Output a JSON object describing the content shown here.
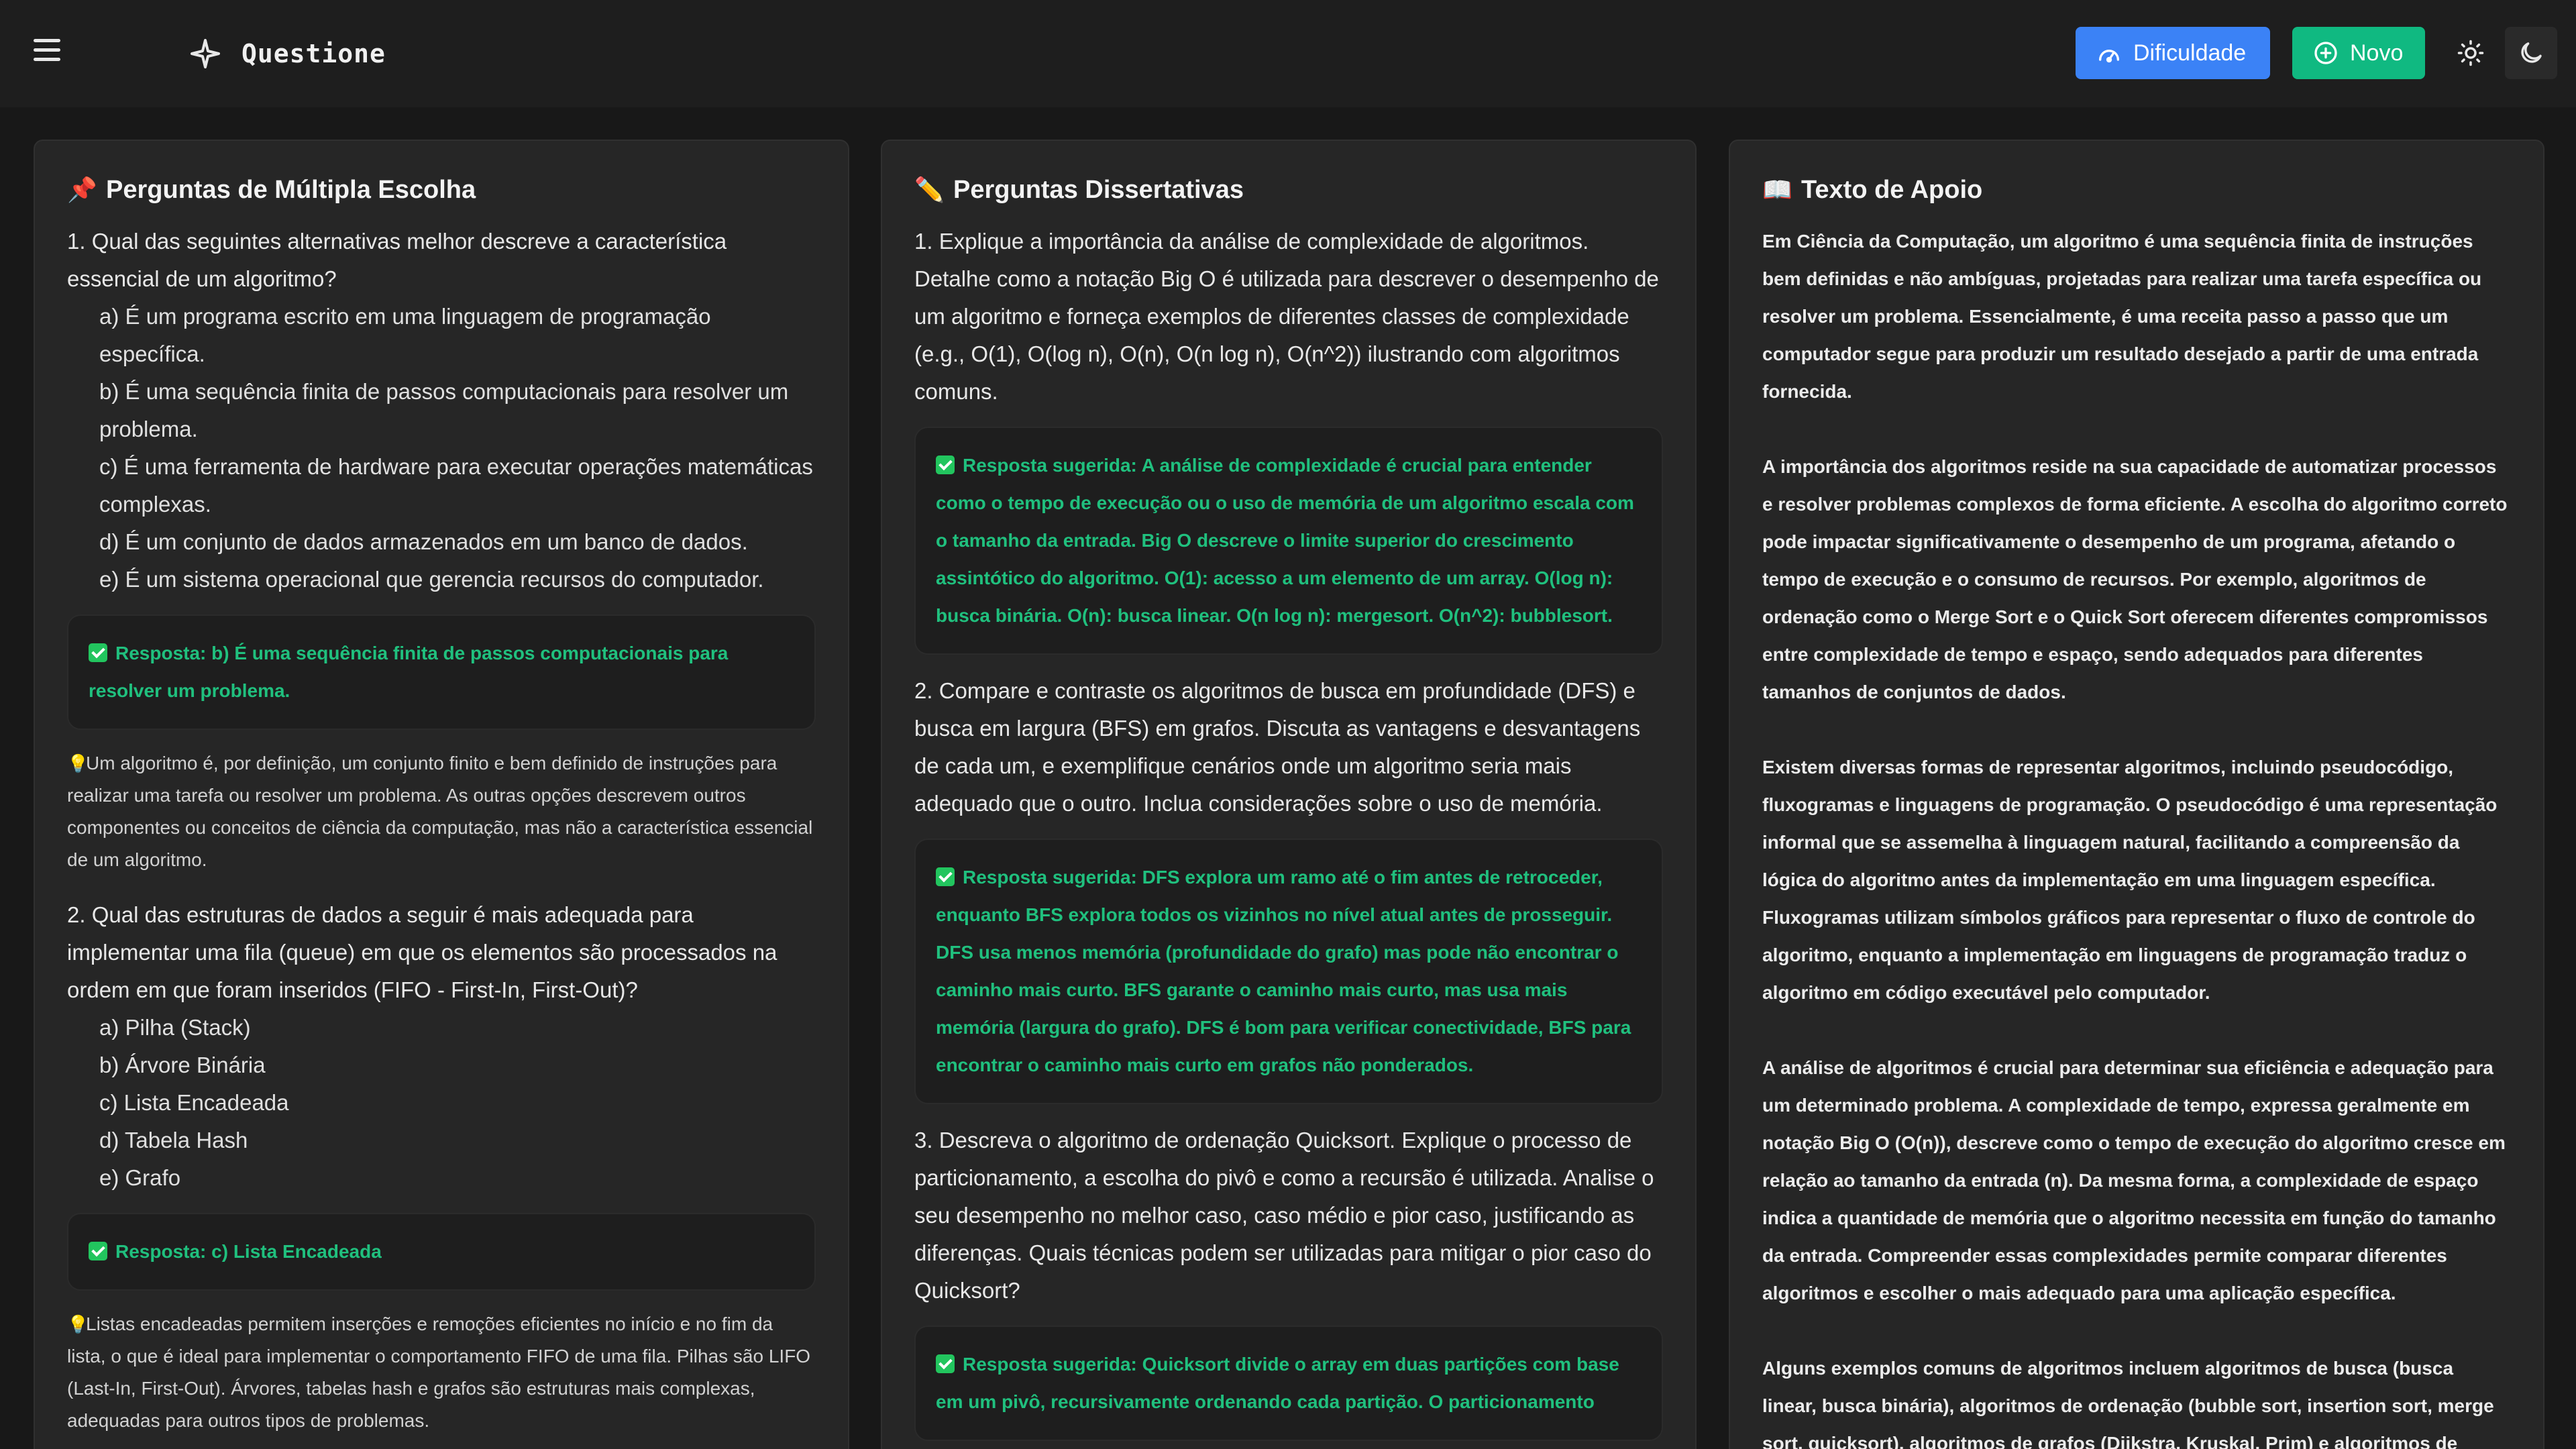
{
  "header": {
    "title": "Questione",
    "difficulty_label": "Dificuldade",
    "new_label": "Novo"
  },
  "colors": {
    "accent_blue": "#3b82f6",
    "accent_green": "#10b981",
    "answer_green": "#20c07e"
  },
  "mc": {
    "heading": "Perguntas de Múltipla Escolha",
    "heading_emoji": "📌",
    "questions": [
      {
        "text": "1. Qual das seguintes alternativas melhor descreve a característica essencial de um algoritmo?",
        "options": [
          "a) É um programa escrito em uma linguagem de programação específica.",
          "b) É uma sequência finita de passos computacionais para resolver um problema.",
          "c) É uma ferramenta de hardware para executar operações matemáticas complexas.",
          "d) É um conjunto de dados armazenados em um banco de dados.",
          "e) É um sistema operacional que gerencia recursos do computador."
        ],
        "answer": "Resposta: b) É uma sequência finita de passos computacionais para resolver um problema.",
        "explanation": "Um algoritmo é, por definição, um conjunto finito e bem definido de instruções para realizar uma tarefa ou resolver um problema. As outras opções descrevem outros componentes ou conceitos de ciência da computação, mas não a característica essencial de um algoritmo."
      },
      {
        "text": "2. Qual das estruturas de dados a seguir é mais adequada para implementar uma fila (queue) em que os elementos são processados na ordem em que foram inseridos (FIFO - First-In, First-Out)?",
        "options": [
          "a) Pilha (Stack)",
          "b) Árvore Binária",
          "c) Lista Encadeada",
          "d) Tabela Hash",
          "e) Grafo"
        ],
        "answer": "Resposta: c) Lista Encadeada",
        "explanation": "Listas encadeadas permitem inserções e remoções eficientes no início e no fim da lista, o que é ideal para implementar o comportamento FIFO de uma fila. Pilhas são LIFO (Last-In, First-Out). Árvores, tabelas hash e grafos são estruturas mais complexas, adequadas para outros tipos de problemas."
      }
    ]
  },
  "essay": {
    "heading": "Perguntas Dissertativas",
    "heading_emoji": "✏️",
    "questions": [
      {
        "text": "1. Explique a importância da análise de complexidade de algoritmos. Detalhe como a notação Big O é utilizada para descrever o desempenho de um algoritmo e forneça exemplos de diferentes classes de complexidade (e.g., O(1), O(log n), O(n), O(n log n), O(n^2)) ilustrando com algoritmos comuns.",
        "answer": "Resposta sugerida: A análise de complexidade é crucial para entender como o tempo de execução ou o uso de memória de um algoritmo escala com o tamanho da entrada. Big O descreve o limite superior do crescimento assintótico do algoritmo. O(1): acesso a um elemento de um array. O(log n): busca binária. O(n): busca linear. O(n log n): mergesort. O(n^2): bubblesort."
      },
      {
        "text": "2. Compare e contraste os algoritmos de busca em profundidade (DFS) e busca em largura (BFS) em grafos. Discuta as vantagens e desvantagens de cada um, e exemplifique cenários onde um algoritmo seria mais adequado que o outro. Inclua considerações sobre o uso de memória.",
        "answer": "Resposta sugerida: DFS explora um ramo até o fim antes de retroceder, enquanto BFS explora todos os vizinhos no nível atual antes de prosseguir. DFS usa menos memória (profundidade do grafo) mas pode não encontrar o caminho mais curto. BFS garante o caminho mais curto, mas usa mais memória (largura do grafo). DFS é bom para verificar conectividade, BFS para encontrar o caminho mais curto em grafos não ponderados."
      },
      {
        "text": "3. Descreva o algoritmo de ordenação Quicksort. Explique o processo de particionamento, a escolha do pivô e como a recursão é utilizada. Analise o seu desempenho no melhor caso, caso médio e pior caso, justificando as diferenças. Quais técnicas podem ser utilizadas para mitigar o pior caso do Quicksort?",
        "answer": "Resposta sugerida: Quicksort divide o array em duas partições com base em um pivô, recursivamente ordenando cada partição. O particionamento"
      }
    ]
  },
  "support": {
    "heading": "Texto de Apoio",
    "heading_emoji": "📖",
    "paragraphs": [
      "Em Ciência da Computação, um algoritmo é uma sequência finita de instruções bem definidas e não ambíguas, projetadas para realizar uma tarefa específica ou resolver um problema. Essencialmente, é uma receita passo a passo que um computador segue para produzir um resultado desejado a partir de uma entrada fornecida.",
      "A importância dos algoritmos reside na sua capacidade de automatizar processos e resolver problemas complexos de forma eficiente. A escolha do algoritmo correto pode impactar significativamente o desempenho de um programa, afetando o tempo de execução e o consumo de recursos. Por exemplo, algoritmos de ordenação como o Merge Sort e o Quick Sort oferecem diferentes compromissos entre complexidade de tempo e espaço, sendo adequados para diferentes tamanhos de conjuntos de dados.",
      "Existem diversas formas de representar algoritmos, incluindo pseudocódigo, fluxogramas e linguagens de programação. O pseudocódigo é uma representação informal que se assemelha à linguagem natural, facilitando a compreensão da lógica do algoritmo antes da implementação em uma linguagem específica. Fluxogramas utilizam símbolos gráficos para representar o fluxo de controle do algoritmo, enquanto a implementação em linguagens de programação traduz o algoritmo em código executável pelo computador.",
      "A análise de algoritmos é crucial para determinar sua eficiência e adequação para um determinado problema. A complexidade de tempo, expressa geralmente em notação Big O (O(n)), descreve como o tempo de execução do algoritmo cresce em relação ao tamanho da entrada (n). Da mesma forma, a complexidade de espaço indica a quantidade de memória que o algoritmo necessita em função do tamanho da entrada. Compreender essas complexidades permite comparar diferentes algoritmos e escolher o mais adequado para uma aplicação específica.",
      "Alguns exemplos comuns de algoritmos incluem algoritmos de busca (busca linear, busca binária), algoritmos de ordenação (bubble sort, insertion sort, merge sort, quicksort), algoritmos de grafos (Dijkstra, Kruskal, Prim) e algoritmos de"
    ]
  }
}
